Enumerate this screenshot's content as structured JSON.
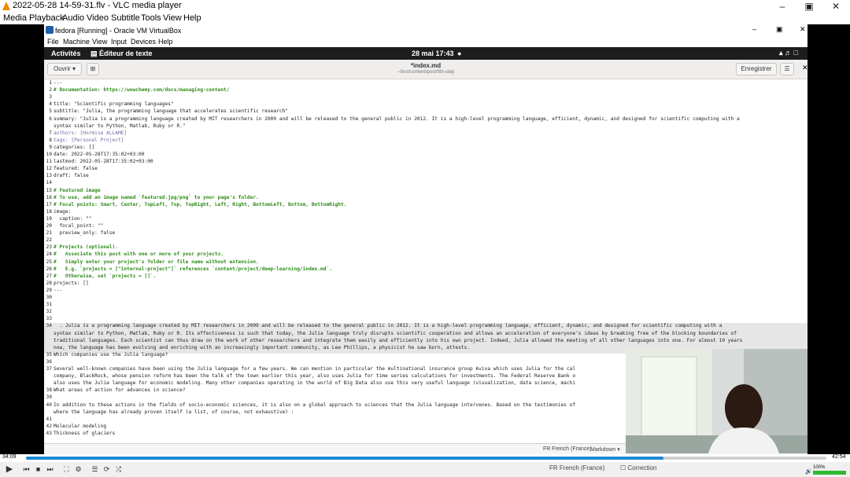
{
  "vlc": {
    "window_title": "2022-05-28 14-59-31.flv - VLC media player",
    "menu": [
      "Media",
      "Playback",
      "Audio",
      "Video",
      "Subtitle",
      "Tools",
      "View",
      "Help"
    ],
    "elapsed": "34:09",
    "total": "42:54",
    "progress": 0.796,
    "volume": "100%",
    "volume_level": 1.0
  },
  "vbox": {
    "title": "fedora [Running] - Oracle VM VirtualBox",
    "menu": [
      "File",
      "Machine",
      "View",
      "Input",
      "Devices",
      "Help"
    ]
  },
  "gnome": {
    "activities": "Activités",
    "app": "Éditeur de texte",
    "clock": "28 mai  17:43"
  },
  "gedit": {
    "open_label": "Ouvrir",
    "filename": "*index.md",
    "path": "~/test/content/post/5th-step",
    "save_label": "Enregistrer",
    "lang_label": "Markdown",
    "spell_lang": "FR French (France)",
    "spell_label": "Correction"
  },
  "editor_lines": [
    {
      "n": "1",
      "t": "---",
      "k": ""
    },
    {
      "n": "2",
      "t": "# Documentation: https://wowchemy.com/docs/managing-content/",
      "k": "cmt"
    },
    {
      "n": "3",
      "t": "",
      "k": ""
    },
    {
      "n": "4",
      "t": "title: \"Scientific programming languages\"",
      "k": ""
    },
    {
      "n": "5",
      "t": "subtitle: \"Julia, the programming language that accelerates scientific research\"",
      "k": ""
    },
    {
      "n": "6",
      "t": "summary: \"Julia is a programming language created by MIT researchers in 2009 and will be released to the general public in 2012. It is a high-level programming language, efficient, dynamic, and designed for scientific computing with a",
      "k": ""
    },
    {
      "n": "",
      "t": "syntax similar to Python, Matlab, Ruby or R.\"",
      "k": ""
    },
    {
      "n": "7",
      "t": "authors: [Hormise ALLAME]",
      "k": "val"
    },
    {
      "n": "8",
      "t": "tags: [Personal Project]",
      "k": "val"
    },
    {
      "n": "9",
      "t": "categories: []",
      "k": ""
    },
    {
      "n": "10",
      "t": "date: 2022-05-28T17:35:02+03:00",
      "k": ""
    },
    {
      "n": "11",
      "t": "lastmod: 2022-05-28T17:35:02+03:00",
      "k": ""
    },
    {
      "n": "12",
      "t": "featured: false",
      "k": ""
    },
    {
      "n": "13",
      "t": "draft: false",
      "k": ""
    },
    {
      "n": "14",
      "t": "",
      "k": ""
    },
    {
      "n": "15",
      "t": "# Featured image",
      "k": "cmt"
    },
    {
      "n": "16",
      "t": "# To use, add an image named `featured.jpg/png` to your page's folder.",
      "k": "cmt"
    },
    {
      "n": "17",
      "t": "# Focal points: Smart, Center, TopLeft, Top, TopRight, Left, Right, BottomLeft, Bottom, BottomRight.",
      "k": "cmt"
    },
    {
      "n": "18",
      "t": "image:",
      "k": ""
    },
    {
      "n": "19",
      "t": "  caption: \"\"",
      "k": ""
    },
    {
      "n": "20",
      "t": "  focal_point: \"\"",
      "k": ""
    },
    {
      "n": "21",
      "t": "  preview_only: false",
      "k": ""
    },
    {
      "n": "22",
      "t": "",
      "k": ""
    },
    {
      "n": "23",
      "t": "# Projects (optional).",
      "k": "cmt"
    },
    {
      "n": "24",
      "t": "#   Associate this post with one or more of your projects.",
      "k": "cmt"
    },
    {
      "n": "25",
      "t": "#   Simply enter your project's folder or file name without extension.",
      "k": "cmt"
    },
    {
      "n": "26",
      "t": "#   E.g. `projects = [\"internal-project\"]` references `content/project/deep-learning/index.md`.",
      "k": "cmt"
    },
    {
      "n": "27",
      "t": "#   Otherwise, set `projects = []`.",
      "k": "cmt"
    },
    {
      "n": "28",
      "t": "projects: []",
      "k": ""
    },
    {
      "n": "29",
      "t": "---",
      "k": ""
    },
    {
      "n": "30",
      "t": "",
      "k": ""
    },
    {
      "n": "31",
      "t": "",
      "k": ""
    },
    {
      "n": "32",
      "t": "",
      "k": ""
    },
    {
      "n": "33",
      "t": "",
      "k": ""
    },
    {
      "n": "34",
      "t": "  . Julia is a programming language created by MIT researchers in 2009 and will be released to the general public in 2012. It is a high-level programming language, efficient, dynamic, and designed for scientific computing with a",
      "k": ""
    },
    {
      "n": "",
      "t": "syntax similar to Python, Matlab, Ruby or R. Its effectiveness is such that today, the Julia language truly disrupts scientific cooperation and allows an acceleration of everyone's ideas by breaking free of the blocking boundaries of",
      "k": ""
    },
    {
      "n": "",
      "t": "traditional languages. Each scientist can thus draw on the work of other researchers and integrate them easily and efficiently into his own project. Indeed, Julia allowed the meeting of all other languages into one. For almost 10 years",
      "k": ""
    },
    {
      "n": "",
      "t": "now, the language has been evolving and enriching with an increasingly important community, as Lee Phillips, a physicist he saw born, attests.",
      "k": ""
    },
    {
      "n": "35",
      "t": "Which companies use the Julia language?",
      "k": ""
    },
    {
      "n": "36",
      "t": "",
      "k": ""
    },
    {
      "n": "37",
      "t": "Several well-known companies have been using the Julia language for a few years. We can mention in particular the multinational insurance group Aviva which uses Julia for the cal",
      "k": ""
    },
    {
      "n": "",
      "t": "company, BlackRock, whose pension reform has been the talk of the town earlier this year, also uses Julia for time series calculations for investments. The Federal Reserve Bank o",
      "k": ""
    },
    {
      "n": "",
      "t": "also uses the Julia language for economic modeling. Many other companies operating in the world of Big Data also use this very useful language (visualization, data science, machi",
      "k": ""
    },
    {
      "n": "38",
      "t": "What areas of action for advances in science?",
      "k": ""
    },
    {
      "n": "39",
      "t": "",
      "k": ""
    },
    {
      "n": "40",
      "t": "In addition to these actions in the fields of socio-economic sciences, it is also on a global approach to sciences that the Julia language intervenes. Based on the testimonies of",
      "k": ""
    },
    {
      "n": "",
      "t": "where the language has already proven itself (a list, of course, not exhaustive) :",
      "k": ""
    },
    {
      "n": "41",
      "t": "",
      "k": ""
    },
    {
      "n": "42",
      "t": "Molecular modeling",
      "k": ""
    },
    {
      "n": "43",
      "t": "Thickness of glaciers",
      "k": ""
    }
  ]
}
